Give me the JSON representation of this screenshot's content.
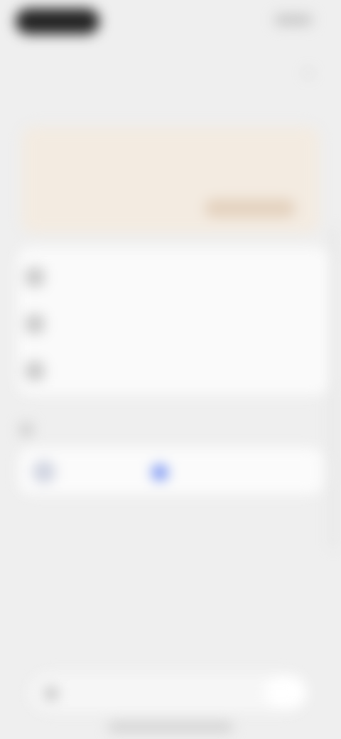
{
  "header": {
    "title": "",
    "close_icon": "close-icon"
  },
  "banner": {
    "text": "",
    "button_label": ""
  },
  "options": [
    {
      "icon": "user-icon",
      "label": ""
    },
    {
      "icon": "settings-icon",
      "label": ""
    },
    {
      "icon": "lock-icon",
      "label": ""
    }
  ],
  "account": {
    "name": "",
    "verified_icon": "verified-badge-icon"
  },
  "composer": {
    "placeholder": ""
  },
  "colors": {
    "background": "#efefef",
    "banner_bg": "#f3ebe1",
    "banner_button": "#e4d2bf",
    "accent_blue": "#6f8cf2"
  }
}
